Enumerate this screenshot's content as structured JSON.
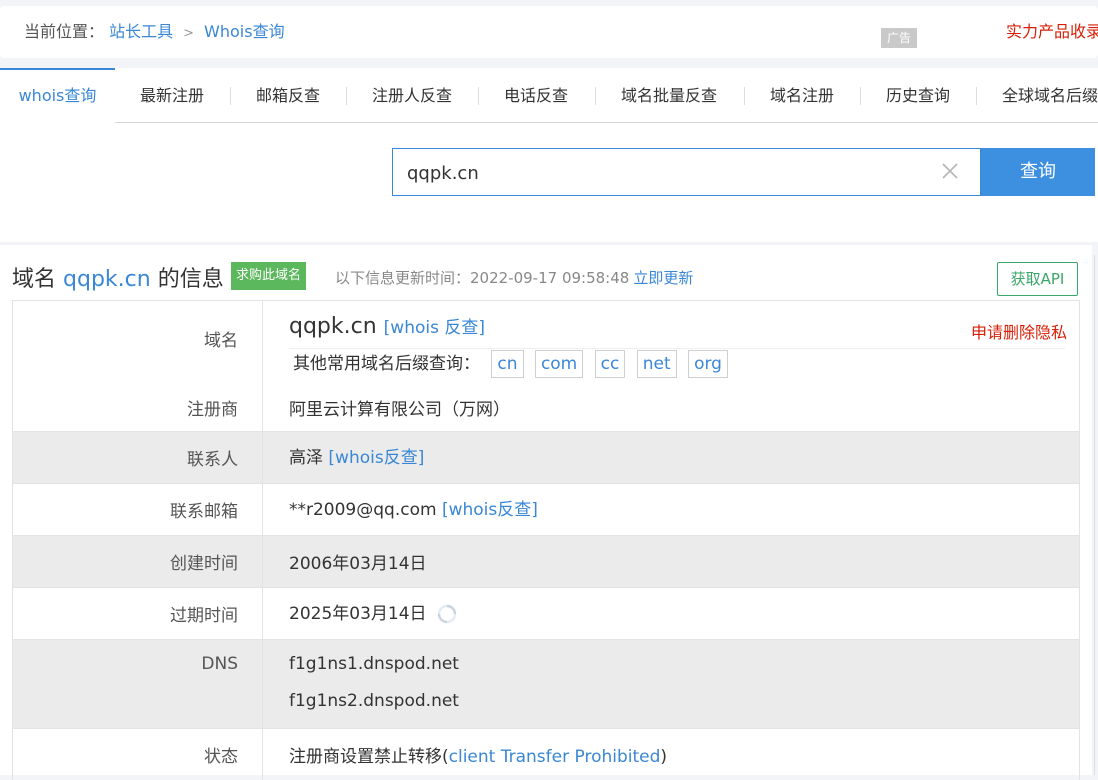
{
  "breadcrumb": {
    "lead": "当前位置：",
    "items": [
      "站长工具",
      "Whois查询"
    ],
    "sep": ">"
  },
  "ad_tag": "广告",
  "promo": "实力产品收录",
  "tabs": [
    {
      "label": "whois查询",
      "active": true
    },
    {
      "label": "最新注册"
    },
    {
      "label": "邮箱反查"
    },
    {
      "label": "注册人反查"
    },
    {
      "label": "电话反查"
    },
    {
      "label": "域名批量反查"
    },
    {
      "label": "域名注册"
    },
    {
      "label": "历史查询"
    },
    {
      "label": "全球域名后缀"
    }
  ],
  "search": {
    "value": "qqpk.cn",
    "button": "查询"
  },
  "header": {
    "pre": "域名",
    "domain": "qqpk.cn",
    "post": "的信息",
    "buy_badge": "求购此域名",
    "update_text": "以下信息更新时间：2022-09-17 09:58:48",
    "update_link": "立即更新",
    "api_button": "获取API"
  },
  "info": {
    "domain_label": "域名",
    "domain_value": "qqpk.cn",
    "domain_whois": "[whois 反查]",
    "privacy_link": "申请删除隐私",
    "suffix_label": "其他常用域名后缀查询：",
    "suffixes": [
      "cn",
      "com",
      "cc",
      "net",
      "org"
    ],
    "registrar_label": "注册商",
    "registrar_value": "阿里云计算有限公司（万网）",
    "contact_label": "联系人",
    "contact_value": "高泽",
    "contact_whois": "[whois反查]",
    "email_label": "联系邮箱",
    "email_value": "**r2009@qq.com",
    "email_whois": "[whois反查]",
    "created_label": "创建时间",
    "created_value": "2006年03月14日",
    "expire_label": "过期时间",
    "expire_value": "2025年03月14日",
    "dns_label": "DNS",
    "dns_values": [
      "f1g1ns1.dnspod.net",
      "f1g1ns2.dnspod.net"
    ],
    "status_label": "状态",
    "status_prefix": "注册商设置禁止转移(",
    "status_en": "client Transfer Prohibited",
    "status_suffix": ")"
  },
  "colors": {
    "accent": "#3a87d6",
    "button": "#3d8fe0",
    "badge_green": "#5cb85c",
    "api_green": "#3aa568",
    "alert_red": "#d81e06"
  }
}
